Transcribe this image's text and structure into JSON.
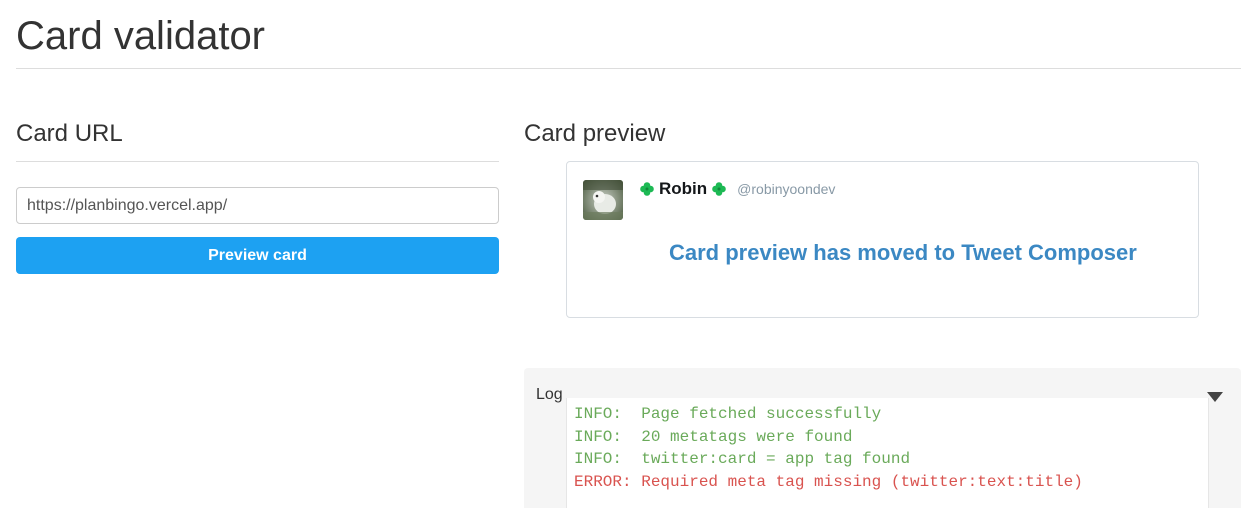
{
  "page": {
    "title": "Card validator"
  },
  "card_url": {
    "heading": "Card URL",
    "input_value": "https://planbingo.vercel.app/",
    "button_label": "Preview card"
  },
  "card_preview": {
    "heading": "Card preview",
    "author_name": "Robin",
    "author_handle": "@robinyoondev",
    "message": "Card preview has moved to Tweet Composer",
    "icons": [
      "avatar-image",
      "clover-icon",
      "clover-icon"
    ]
  },
  "log": {
    "label": "Log",
    "toggle_icon": "triangle-down-icon",
    "lines": [
      {
        "level": "info",
        "text": "INFO:  Page fetched successfully"
      },
      {
        "level": "info",
        "text": "INFO:  20 metatags were found"
      },
      {
        "level": "info",
        "text": "INFO:  twitter:card = app tag found"
      },
      {
        "level": "error",
        "text": "ERROR: Required meta tag missing (twitter:text:title)"
      }
    ]
  },
  "colors": {
    "button": "#1da1f2",
    "preview_message": "#3b88c3",
    "info": "#6aaa5a",
    "error": "#d9534f",
    "clover": "#1db954"
  }
}
